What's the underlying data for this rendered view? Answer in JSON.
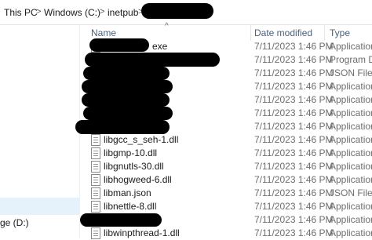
{
  "address": {
    "crumbs": [
      "This PC",
      "Windows (C:)",
      "inetpub"
    ],
    "separator": ">"
  },
  "nav": {
    "drive_label": "ge (D:)"
  },
  "columns": {
    "name": "Name",
    "date": "Date modified",
    "type": "Type"
  },
  "files": [
    {
      "name": "",
      "name_tail": "exe",
      "date": "7/11/2023 1:46 PM",
      "type": "Application",
      "redacted": true
    },
    {
      "name": "",
      "name_tail": "",
      "date": "7/11/2023 1:46 PM",
      "type": "Program Dell",
      "redacted": true
    },
    {
      "name": "",
      "name_tail": "",
      "date": "7/11/2023 1:46 PM",
      "type": "JSON File",
      "redacted": true
    },
    {
      "name": "",
      "name_tail": "",
      "date": "7/11/2023 1:46 PM",
      "type": "Application",
      "redacted": true
    },
    {
      "name": "",
      "name_tail": "",
      "date": "7/11/2023 1:46 PM",
      "type": "Application",
      "redacted": true
    },
    {
      "name": "",
      "name_tail": "",
      "date": "7/11/2023 1:46 PM",
      "type": "Application",
      "redacted": true
    },
    {
      "name": "",
      "name_tail": "",
      "date": "7/11/2023 1:46 PM",
      "type": "Application",
      "redacted": true
    },
    {
      "name": "libgcc_s_seh-1.dll",
      "name_tail": "",
      "date": "7/11/2023 1:46 PM",
      "type": "Application",
      "redacted": false
    },
    {
      "name": "libgmp-10.dll",
      "name_tail": "",
      "date": "7/11/2023 1:46 PM",
      "type": "Application",
      "redacted": false
    },
    {
      "name": "libgnutls-30.dll",
      "name_tail": "",
      "date": "7/11/2023 1:46 PM",
      "type": "Application",
      "redacted": false
    },
    {
      "name": "libhogweed-6.dll",
      "name_tail": "",
      "date": "7/11/2023 1:46 PM",
      "type": "Application",
      "redacted": false
    },
    {
      "name": "libman.json",
      "name_tail": "",
      "date": "7/11/2023 1:46 PM",
      "type": "JSON File",
      "redacted": false
    },
    {
      "name": "libnettle-8.dll",
      "name_tail": "",
      "date": "7/11/2023 1:46 PM",
      "type": "Application",
      "redacted": false
    },
    {
      "name": "",
      "name_tail": "",
      "date": "7/11/2023 1:46 PM",
      "type": "Application",
      "redacted": true
    },
    {
      "name": "libwinpthread-1.dll",
      "name_tail": "",
      "date": "7/11/2023 1:46 PM",
      "type": "Application",
      "redacted": false
    }
  ]
}
